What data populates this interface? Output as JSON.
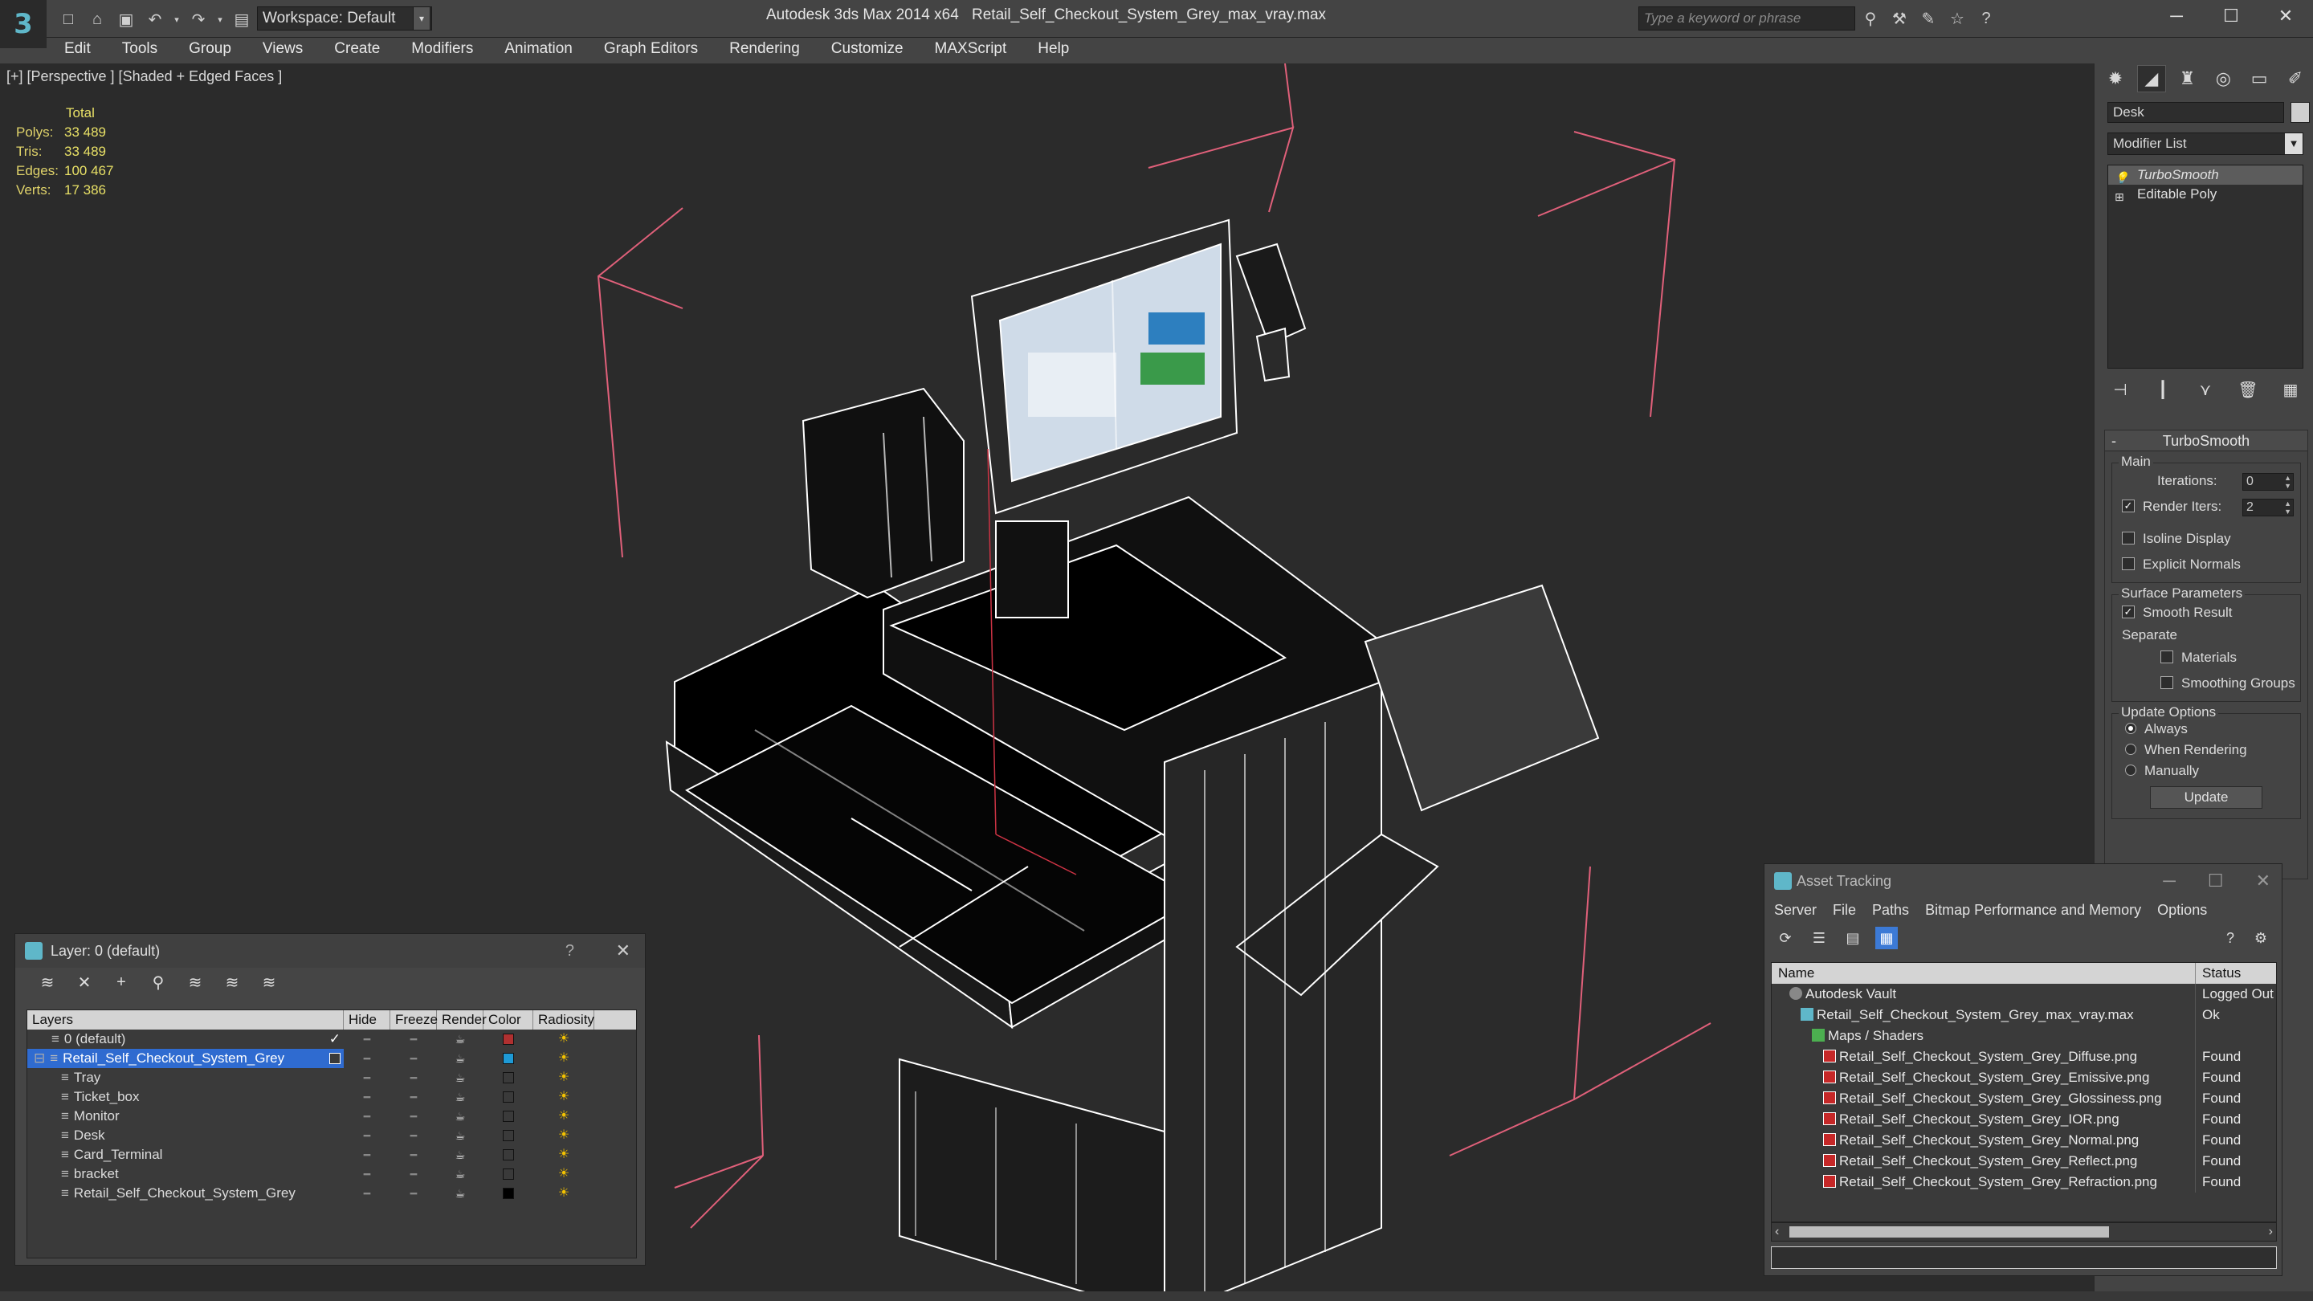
{
  "app": {
    "title": "Autodesk 3ds Max  2014 x64",
    "file": "Retail_Self_Checkout_System_Grey_max_vray.max",
    "workspace": "Workspace: Default",
    "search_placeholder": "Type a keyword or phrase"
  },
  "menu": [
    "Edit",
    "Tools",
    "Group",
    "Views",
    "Create",
    "Modifiers",
    "Animation",
    "Graph Editors",
    "Rendering",
    "Customize",
    "MAXScript",
    "Help"
  ],
  "viewport": {
    "label": "[+] [Perspective ] [Shaded + Edged Faces ]",
    "stats": {
      "header": "Total",
      "rows": [
        {
          "label": "Polys:",
          "value": "33 489"
        },
        {
          "label": "Tris:",
          "value": "33 489"
        },
        {
          "label": "Edges:",
          "value": "100 467"
        },
        {
          "label": "Verts:",
          "value": "17 386"
        }
      ]
    }
  },
  "command_panel": {
    "object_name": "Desk",
    "modifier_list": "Modifier List",
    "stack": [
      "TurboSmooth",
      "Editable Poly"
    ],
    "rollout": {
      "title": "TurboSmooth",
      "main_label": "Main",
      "iterations_label": "Iterations:",
      "iterations_value": "0",
      "render_iters_label": "Render Iters:",
      "render_iters_value": "2",
      "isoline": "Isoline Display",
      "explicit": "Explicit Normals",
      "surface_label": "Surface Parameters",
      "smooth_result": "Smooth Result",
      "separate": "Separate",
      "materials": "Materials",
      "smoothing_groups": "Smoothing Groups",
      "update_label": "Update Options",
      "always": "Always",
      "when_rendering": "When Rendering",
      "manually": "Manually",
      "update_button": "Update"
    }
  },
  "layer_dialog": {
    "title": "Layer: 0 (default)",
    "help": "?",
    "columns": [
      "Layers",
      "Hide",
      "Freeze",
      "Render",
      "Color",
      "Radiosity"
    ],
    "rows": [
      {
        "name": "0 (default)",
        "indent": 1,
        "color": "#b03030",
        "selected": false,
        "check": true
      },
      {
        "name": "Retail_Self_Checkout_System_Grey",
        "indent": 0,
        "color": "#1e9ad6",
        "selected": true,
        "check": false
      },
      {
        "name": "Tray",
        "indent": 2,
        "color": "#3a3a3a",
        "selected": false,
        "check": false
      },
      {
        "name": "Ticket_box",
        "indent": 2,
        "color": "#3a3a3a",
        "selected": false,
        "check": false
      },
      {
        "name": "Monitor",
        "indent": 2,
        "color": "#3a3a3a",
        "selected": false,
        "check": false
      },
      {
        "name": "Desk",
        "indent": 2,
        "color": "#3a3a3a",
        "selected": false,
        "check": false
      },
      {
        "name": "Card_Terminal",
        "indent": 2,
        "color": "#3a3a3a",
        "selected": false,
        "check": false
      },
      {
        "name": "bracket",
        "indent": 2,
        "color": "#3a3a3a",
        "selected": false,
        "check": false
      },
      {
        "name": "Retail_Self_Checkout_System_Grey",
        "indent": 2,
        "color": "#000000",
        "selected": false,
        "check": false
      }
    ]
  },
  "asset_dialog": {
    "title": "Asset Tracking",
    "menu": [
      "Server",
      "File",
      "Paths",
      "Bitmap Performance and Memory",
      "Options"
    ],
    "columns": [
      "Name",
      "Status"
    ],
    "rows": [
      {
        "name": "Autodesk Vault",
        "status": "Logged Out",
        "indent": 1,
        "icon": "vault"
      },
      {
        "name": "Retail_Self_Checkout_System_Grey_max_vray.max",
        "status": "Ok",
        "indent": 2,
        "icon": "max"
      },
      {
        "name": "Maps / Shaders",
        "status": "",
        "indent": 3,
        "icon": "folder"
      },
      {
        "name": "Retail_Self_Checkout_System_Grey_Diffuse.png",
        "status": "Found",
        "indent": 4,
        "icon": "png"
      },
      {
        "name": "Retail_Self_Checkout_System_Grey_Emissive.png",
        "status": "Found",
        "indent": 4,
        "icon": "png"
      },
      {
        "name": "Retail_Self_Checkout_System_Grey_Glossiness.png",
        "status": "Found",
        "indent": 4,
        "icon": "png"
      },
      {
        "name": "Retail_Self_Checkout_System_Grey_IOR.png",
        "status": "Found",
        "indent": 4,
        "icon": "png"
      },
      {
        "name": "Retail_Self_Checkout_System_Grey_Normal.png",
        "status": "Found",
        "indent": 4,
        "icon": "png"
      },
      {
        "name": "Retail_Self_Checkout_System_Grey_Reflect.png",
        "status": "Found",
        "indent": 4,
        "icon": "png"
      },
      {
        "name": "Retail_Self_Checkout_System_Grey_Refraction.png",
        "status": "Found",
        "indent": 4,
        "icon": "png"
      }
    ]
  }
}
